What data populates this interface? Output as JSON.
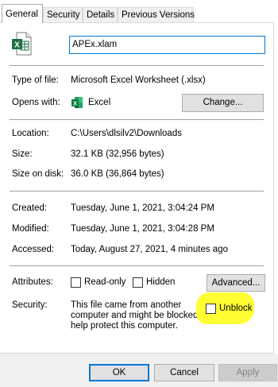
{
  "tabs": [
    {
      "label": "General"
    },
    {
      "label": "Security"
    },
    {
      "label": "Details"
    },
    {
      "label": "Previous Versions"
    }
  ],
  "file": {
    "name": "APEx.xlam",
    "icon": "excel-file-icon"
  },
  "fields": {
    "type_label": "Type of file:",
    "type_value": "Microsoft Excel Worksheet (.xlsx)",
    "opens_label": "Opens with:",
    "opens_value": "Excel",
    "change_label": "Change...",
    "location_label": "Location:",
    "location_value": "C:\\Users\\dlsilv2\\Downloads",
    "size_label": "Size:",
    "size_value": "32.1 KB (32,956 bytes)",
    "sizeondisk_label": "Size on disk:",
    "sizeondisk_value": "36.0 KB (36,864 bytes)",
    "created_label": "Created:",
    "created_value": "Tuesday, June 1, 2021, 3:04:24 PM",
    "modified_label": "Modified:",
    "modified_value": "Tuesday, June 1, 2021, 3:04:28 PM",
    "accessed_label": "Accessed:",
    "accessed_value": "Today, August 27, 2021, 4 minutes ago"
  },
  "attributes": {
    "label": "Attributes:",
    "readonly_label": "Read-only",
    "readonly_checked": false,
    "hidden_label": "Hidden",
    "hidden_checked": false,
    "advanced_label": "Advanced..."
  },
  "security": {
    "label": "Security:",
    "message_line1": "This file came from another",
    "message_line2": "computer and might be blocked to",
    "message_line3": "help protect this computer.",
    "unblock_label": "Unblock",
    "unblock_checked": false,
    "highlight_color": "#ffff33"
  },
  "footer": {
    "ok_label": "OK",
    "cancel_label": "Cancel",
    "apply_label": "Apply"
  },
  "colors": {
    "excel_green": "#1d6f42",
    "focus_blue": "#0078d7"
  }
}
